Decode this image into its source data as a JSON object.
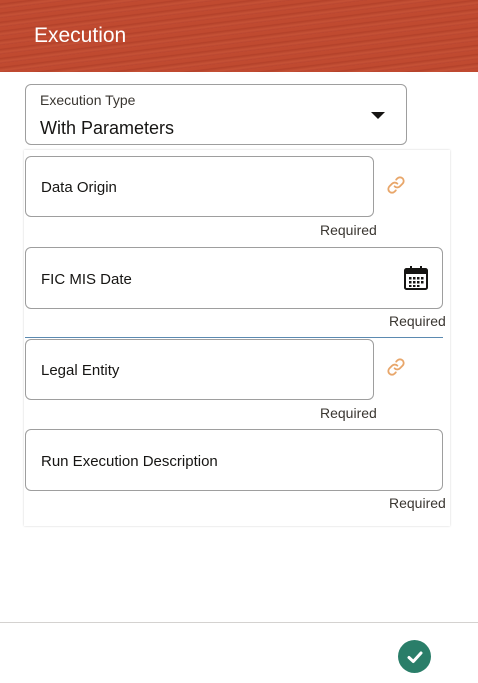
{
  "header": {
    "title": "Execution"
  },
  "execution_type": {
    "label": "Execution Type",
    "value": "With Parameters"
  },
  "fields": [
    {
      "label": "Data Origin",
      "required": "Required",
      "icon": "link-icon"
    },
    {
      "label": "FIC MIS Date",
      "required": "Required",
      "icon": "calendar-icon"
    },
    {
      "label": "Legal Entity",
      "required": "Required",
      "icon": "link-icon"
    },
    {
      "label": "Run Execution Description",
      "required": "Required"
    }
  ],
  "footer": {
    "submit_icon": "check-icon"
  },
  "colors": {
    "header_bg": "#c04a30",
    "link_icon": "#e8a66a",
    "submit_bg": "#2a7e69",
    "divider": "#5b8ab1"
  }
}
